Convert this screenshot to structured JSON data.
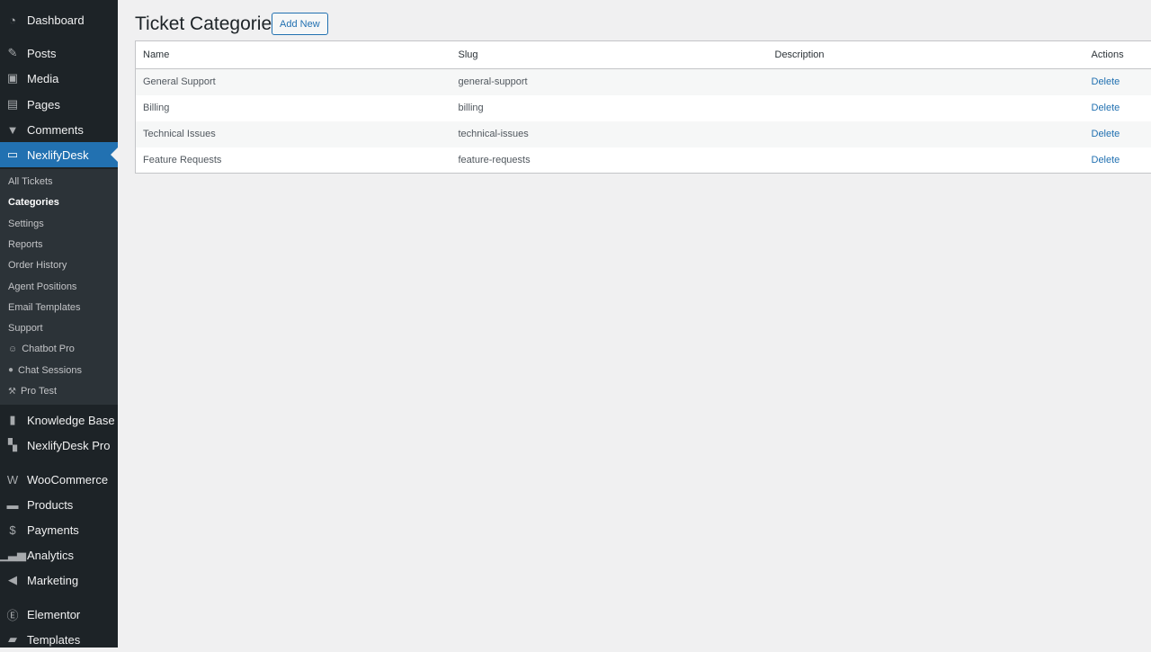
{
  "sidebar": {
    "menu": [
      {
        "label": "Dashboard",
        "icon": "dashboard-icon",
        "glyph": "◔"
      },
      {
        "label": "Posts",
        "icon": "pin-icon",
        "glyph": "✎"
      },
      {
        "label": "Media",
        "icon": "media-icon",
        "glyph": "▣"
      },
      {
        "label": "Pages",
        "icon": "pages-icon",
        "glyph": "▤"
      },
      {
        "label": "Comments",
        "icon": "comment-icon",
        "glyph": "▼"
      },
      {
        "label": "NexlifyDesk",
        "icon": "desk-icon",
        "glyph": "▭",
        "active": true
      }
    ],
    "submenu": [
      {
        "label": "All Tickets"
      },
      {
        "label": "Categories",
        "current": true
      },
      {
        "label": "Settings"
      },
      {
        "label": "Reports"
      },
      {
        "label": "Order History"
      },
      {
        "label": "Agent Positions"
      },
      {
        "label": "Email Templates"
      },
      {
        "label": "Support"
      },
      {
        "label": "Chatbot Pro",
        "icon": "robot-icon",
        "glyph": "☺"
      },
      {
        "label": "Chat Sessions",
        "icon": "chat-bubble-icon",
        "glyph": "●"
      },
      {
        "label": "Pro Test",
        "icon": "wrench-icon",
        "glyph": "⚒"
      }
    ],
    "menu2": [
      {
        "label": "Knowledge Base",
        "icon": "book-icon",
        "glyph": "▮"
      },
      {
        "label": "NexlifyDesk Pro",
        "icon": "chat-icon",
        "glyph": "▚"
      },
      {
        "label": "WooCommerce",
        "icon": "woo-icon",
        "glyph": "W"
      },
      {
        "label": "Products",
        "icon": "archive-icon",
        "glyph": "▬"
      },
      {
        "label": "Payments",
        "icon": "dollar-icon",
        "glyph": "$"
      },
      {
        "label": "Analytics",
        "icon": "bar-chart-icon",
        "glyph": "▁▃▅"
      },
      {
        "label": "Marketing",
        "icon": "megaphone-icon",
        "glyph": "◀"
      },
      {
        "label": "Elementor",
        "icon": "elementor-icon",
        "glyph": "Ⓔ"
      },
      {
        "label": "Templates",
        "icon": "folder-icon",
        "glyph": "▰"
      }
    ]
  },
  "page": {
    "title": "Ticket Categories",
    "add_new": "Add New"
  },
  "table": {
    "headers": [
      "Name",
      "Slug",
      "Description",
      "Actions"
    ],
    "rows": [
      {
        "name": "General Support",
        "slug": "general-support",
        "description": "",
        "action": "Delete"
      },
      {
        "name": "Billing",
        "slug": "billing",
        "description": "",
        "action": "Delete"
      },
      {
        "name": "Technical Issues",
        "slug": "technical-issues",
        "description": "",
        "action": "Delete"
      },
      {
        "name": "Feature Requests",
        "slug": "feature-requests",
        "description": "",
        "action": "Delete"
      }
    ]
  },
  "colors": {
    "sidebar": "#1d2327",
    "accent": "#2271b1",
    "submenu": "#2c3338"
  }
}
